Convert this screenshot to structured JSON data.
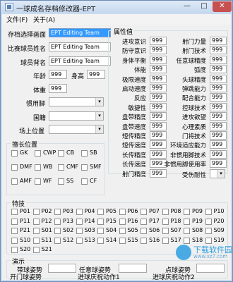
{
  "window": {
    "title": "一球成名存档修改器-EPT",
    "min": "—",
    "max": "□",
    "close": "✕"
  },
  "menu": [
    "文件(F)",
    "关于(A)"
  ],
  "left": {
    "fields": [
      {
        "label": "存档选择画面",
        "value": "EPT Editing Team",
        "selected": true
      },
      {
        "label": "比赛球员姓名",
        "value": "EPT Editing Team"
      },
      {
        "label": "球员背名",
        "value": "EPT Editing Team"
      }
    ],
    "age_label": "年龄",
    "age": "999",
    "height_label": "身高",
    "height": "999",
    "weight_label": "体重",
    "weight": "999",
    "foot_label": "惯用脚",
    "nation_label": "国籍",
    "position_label": "场上位置"
  },
  "positions_group": {
    "title": "擅长位置",
    "items": [
      "GK",
      "CWP",
      "CB",
      "SB",
      "DMF",
      "WB",
      "CMF",
      "SMF",
      "AMF",
      "WF",
      "SS",
      "CF"
    ]
  },
  "attributes": {
    "title": "属性值",
    "left": [
      {
        "label": "进攻意识",
        "value": "999"
      },
      {
        "label": "防守意识",
        "value": "999"
      },
      {
        "label": "身体平衡",
        "value": "999"
      },
      {
        "label": "体能",
        "value": "999"
      },
      {
        "label": "极限速度",
        "value": "999"
      },
      {
        "label": "启动速度",
        "value": "999"
      },
      {
        "label": "反应",
        "value": "999"
      },
      {
        "label": "敏捷性",
        "value": "999"
      },
      {
        "label": "盘带精度",
        "value": "999"
      },
      {
        "label": "盘带速度",
        "value": "999"
      },
      {
        "label": "短传精度",
        "value": "999"
      },
      {
        "label": "短传速度",
        "value": "999"
      },
      {
        "label": "长传精度",
        "value": "999"
      },
      {
        "label": "长传速度",
        "value": "999"
      },
      {
        "label": "射门精度",
        "value": "999"
      }
    ],
    "right": [
      {
        "label": "射门力量",
        "value": "999"
      },
      {
        "label": "射门技术",
        "value": "999"
      },
      {
        "label": "任意球精度",
        "value": "999"
      },
      {
        "label": "弧度",
        "value": "999"
      },
      {
        "label": "头球精度",
        "value": "999"
      },
      {
        "label": "弹跳能力",
        "value": "999"
      },
      {
        "label": "配合能力",
        "value": "999"
      },
      {
        "label": "控球技术",
        "value": "999"
      },
      {
        "label": "进攻欲望",
        "value": "999"
      },
      {
        "label": "心理素质",
        "value": "999"
      },
      {
        "label": "门将技术",
        "value": "999"
      },
      {
        "label": "环境适应能力",
        "value": "999"
      },
      {
        "label": "非惯用脚技术",
        "value": "999"
      },
      {
        "label": "非惯用脚使用率",
        "value": "999"
      }
    ],
    "stability_label": "受伤耐性"
  },
  "specials": {
    "title": "特技",
    "items": [
      "P01",
      "P02",
      "P03",
      "P04",
      "P05",
      "P06",
      "P07",
      "P08",
      "P09",
      "P10",
      "P11",
      "P12",
      "P13",
      "P14",
      "P15",
      "P16",
      "P17",
      "P18",
      "P19",
      "P20",
      "P21",
      "S01",
      "S02",
      "S03",
      "S04",
      "S05",
      "S06",
      "S07",
      "S08",
      "S09",
      "S10",
      "S11",
      "S12",
      "S13",
      "S14",
      "S15",
      "S16",
      "S17",
      "S18",
      "S19",
      "S20",
      "S21"
    ]
  },
  "performance": {
    "title": "演示",
    "labels": [
      "带球姿势",
      "任意球姿势",
      "点球姿势",
      "开门球姿势",
      "进球庆祝动作1",
      "进球庆祝动作2"
    ]
  },
  "watermark": {
    "text": "下载软件园",
    "sub": "www.xz7.com"
  }
}
